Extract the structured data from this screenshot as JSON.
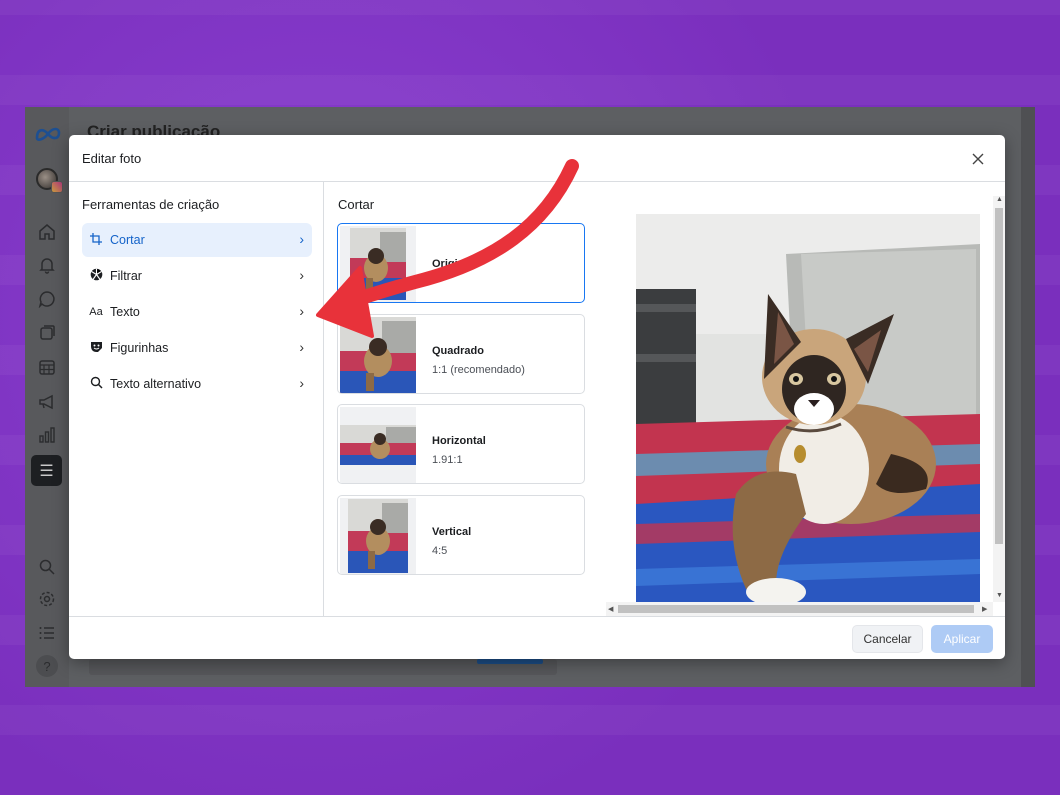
{
  "app": {
    "title": "Criar publicação"
  },
  "modal": {
    "title": "Editar foto",
    "close_icon": "close-icon"
  },
  "tools": {
    "heading": "Ferramentas de criação",
    "items": [
      {
        "label": "Cortar",
        "icon": "crop-icon",
        "active": true
      },
      {
        "label": "Filtrar",
        "icon": "filter-icon",
        "active": false
      },
      {
        "label": "Texto",
        "icon": "text-icon",
        "active": false
      },
      {
        "label": "Figurinhas",
        "icon": "sticker-icon",
        "active": false
      },
      {
        "label": "Texto alternativo",
        "icon": "search-icon",
        "active": false
      }
    ]
  },
  "crop": {
    "heading": "Cortar",
    "options": [
      {
        "name": "Original",
        "ratio": "",
        "selected": true
      },
      {
        "name": "Quadrado",
        "ratio": "1:1 (recomendado)",
        "selected": false
      },
      {
        "name": "Horizontal",
        "ratio": "1.91:1",
        "selected": false
      },
      {
        "name": "Vertical",
        "ratio": "4:5",
        "selected": false
      }
    ]
  },
  "footer": {
    "cancel_label": "Cancelar",
    "apply_label": "Aplicar"
  },
  "sidebar": {
    "icons": [
      "home-icon",
      "notifications-icon",
      "messages-icon",
      "content-icon",
      "planner-icon",
      "ads-icon",
      "insights-icon",
      "menu-icon",
      "search-icon",
      "settings-icon",
      "list-icon",
      "help-icon"
    ]
  },
  "colors": {
    "accent": "#1877f2",
    "arrow": "#e8323a",
    "background": "#7a2fbd"
  }
}
